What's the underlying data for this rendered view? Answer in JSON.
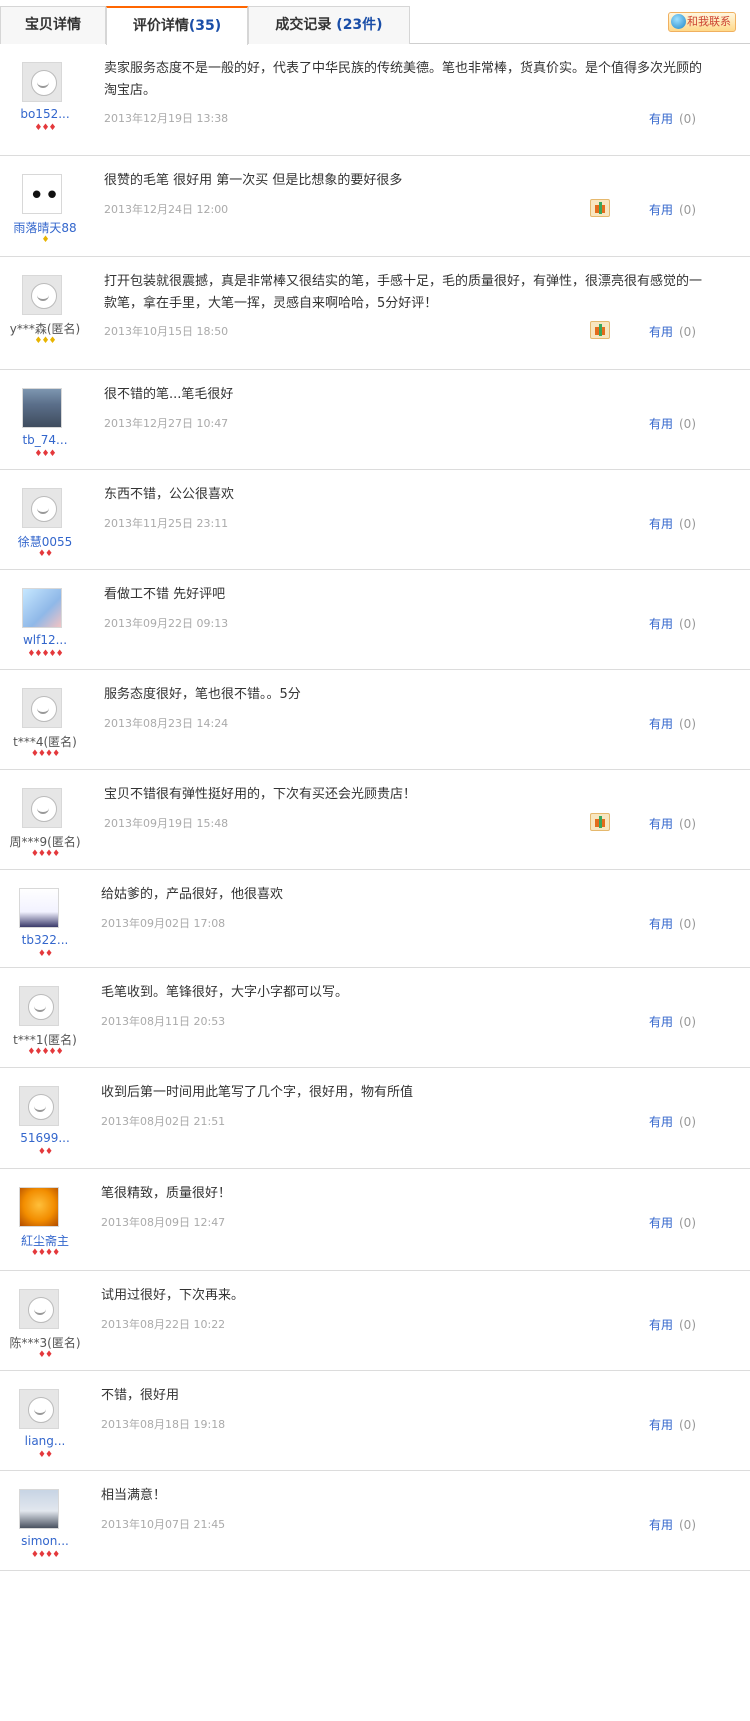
{
  "tabs": [
    {
      "label": "宝贝详情",
      "count": ""
    },
    {
      "label": "评价详情",
      "count": "35"
    },
    {
      "label": "成交记录",
      "count": "23"
    }
  ],
  "tab_count_suffix": "件",
  "contact_label": "和我联系",
  "useful_label": "有用",
  "reviews": [
    {
      "nick": "bo152...",
      "stars": "♦♦♦",
      "star_color": "red",
      "content": "卖家服务态度不是一般的好，代表了中华民族的传统美德。笔也非常棒，货真价实。是个值得多次光顾的淘宝店。",
      "date": "2013年12月19日 13:38",
      "useful_count": "(0)",
      "gift": false,
      "avatar": "default",
      "anon": false
    },
    {
      "nick": "雨落晴天88",
      "stars": "♦",
      "star_color": "gold",
      "content": "很赞的毛笔 很好用 第一次买 但是比想象的要好很多",
      "date": "2013年12月24日 12:00",
      "useful_count": "(0)",
      "gift": true,
      "avatar": "custom1",
      "anon": false
    },
    {
      "nick": "y***森(匿名)",
      "stars": "♦♦♦",
      "star_color": "gold",
      "content": "打开包装就很震撼，真是非常棒又很结实的笔，手感十足，毛的质量很好，有弹性，很漂亮很有感觉的一款笔，拿在手里，大笔一挥，灵感自来啊哈哈，5分好评！",
      "date": "2013年10月15日 18:50",
      "useful_count": "(0)",
      "gift": true,
      "avatar": "default",
      "anon": true
    },
    {
      "nick": "tb_74...",
      "stars": "♦♦♦",
      "star_color": "red",
      "content": "很不错的笔...笔毛很好",
      "date": "2013年12月27日 10:47",
      "useful_count": "(0)",
      "gift": false,
      "avatar": "photo",
      "anon": false
    },
    {
      "nick": "徐慧0055",
      "stars": "♦♦",
      "star_color": "red",
      "content": "东西不错，公公很喜欢",
      "date": "2013年11月25日 23:11",
      "useful_count": "(0)",
      "gift": false,
      "avatar": "default",
      "anon": false
    },
    {
      "nick": "wlf12...",
      "stars": "♦♦♦♦♦",
      "star_color": "red",
      "content": "看做工不错 先好评吧",
      "date": "2013年09月22日 09:13",
      "useful_count": "(0)",
      "gift": false,
      "avatar": "cartoon",
      "anon": false
    },
    {
      "nick": "t***4(匿名)",
      "stars": "♦♦♦♦",
      "star_color": "red",
      "content": "服务态度很好，笔也很不错。。5分",
      "date": "2013年08月23日 14:24",
      "useful_count": "(0)",
      "gift": false,
      "avatar": "default",
      "anon": true
    },
    {
      "nick": "周***9(匿名)",
      "stars": "♦♦♦♦",
      "star_color": "red",
      "content": "宝贝不错很有弹性挺好用的，下次有买还会光顾贵店！",
      "date": "2013年09月19日 15:48",
      "useful_count": "(0)",
      "gift": true,
      "avatar": "default",
      "anon": true
    },
    {
      "nick": "tb322...",
      "stars": "♦♦",
      "star_color": "red",
      "content": "给姑爹的，产品很好，他很喜欢",
      "date": "2013年09月02日 17:08",
      "useful_count": "(0)",
      "gift": false,
      "avatar": "anime",
      "anon": false
    },
    {
      "nick": "t***1(匿名)",
      "stars": "♦♦♦♦♦",
      "star_color": "red",
      "content": "毛笔收到。笔锋很好，大字小字都可以写。",
      "date": "2013年08月11日 20:53",
      "useful_count": "(0)",
      "gift": false,
      "avatar": "default",
      "anon": true
    },
    {
      "nick": "51699...",
      "stars": "♦♦",
      "star_color": "red",
      "content": "收到后第一时间用此笔写了几个字，很好用，物有所值",
      "date": "2013年08月02日 21:51",
      "useful_count": "(0)",
      "gift": false,
      "avatar": "default",
      "anon": false
    },
    {
      "nick": "紅尘斋主",
      "stars": "♦♦♦♦",
      "star_color": "red",
      "content": "笔很精致，质量很好！",
      "date": "2013年08月09日 12:47",
      "useful_count": "(0)",
      "gift": false,
      "avatar": "orange",
      "anon": false
    },
    {
      "nick": "陈***3(匿名)",
      "stars": "♦♦",
      "star_color": "red",
      "content": "试用过很好，下次再来。",
      "date": "2013年08月22日 10:22",
      "useful_count": "(0)",
      "gift": false,
      "avatar": "default",
      "anon": true
    },
    {
      "nick": "liang...",
      "stars": "♦♦",
      "star_color": "red",
      "content": "不错，很好用",
      "date": "2013年08月18日 19:18",
      "useful_count": "(0)",
      "gift": false,
      "avatar": "default",
      "anon": false
    },
    {
      "nick": "simon...",
      "stars": "♦♦♦♦",
      "star_color": "red",
      "content": "相当满意！",
      "date": "2013年10月07日 21:45",
      "useful_count": "(0)",
      "gift": false,
      "avatar": "photo2",
      "anon": false
    }
  ]
}
